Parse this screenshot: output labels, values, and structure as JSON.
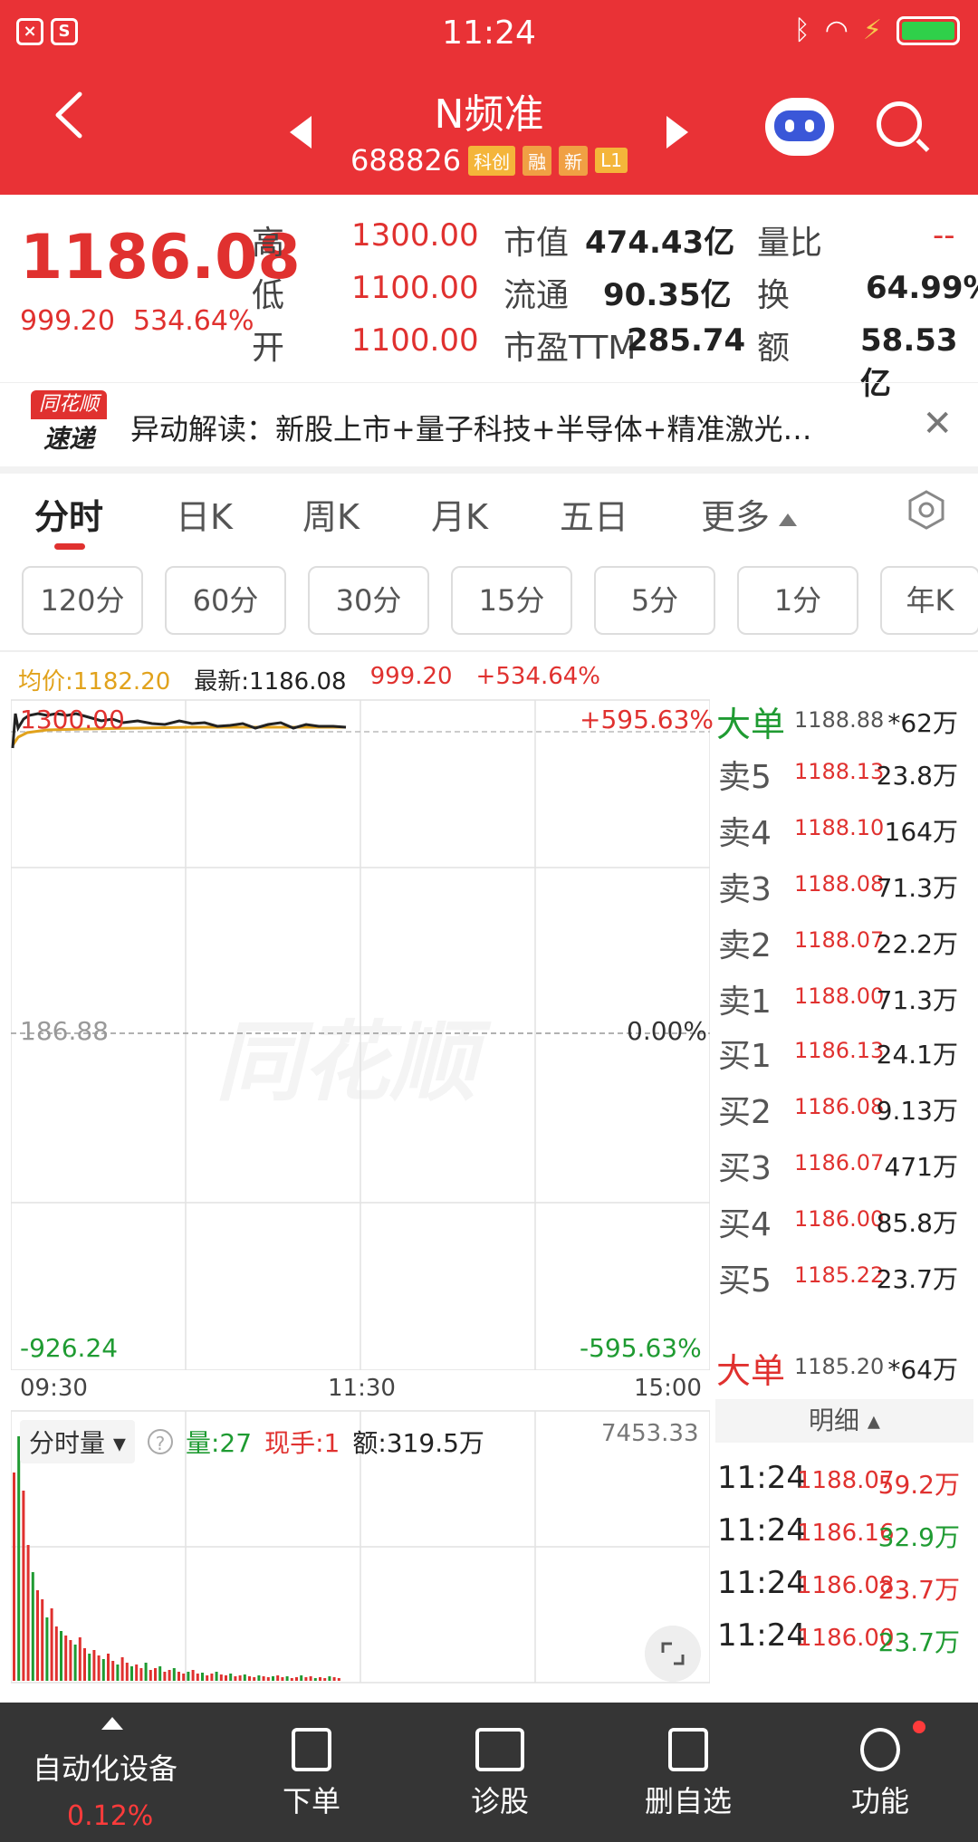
{
  "status_bar": {
    "time": "11:24",
    "left_icons": [
      "close-icon",
      "s-icon"
    ]
  },
  "header": {
    "name": "N频准",
    "code": "688826",
    "tags": [
      "科创",
      "融",
      "新",
      "L1"
    ]
  },
  "quote": {
    "price": "1186.08",
    "change": "999.20",
    "change_pct": "534.64%",
    "high_label": "高",
    "high": "1300.00",
    "low_label": "低",
    "low": "1100.00",
    "open_label": "开",
    "open": "1100.00",
    "mcap_label": "市值",
    "mcap": "474.43亿",
    "float_label": "流通",
    "float": "90.35亿",
    "pe_label": "市盈TTM",
    "pe": "285.74",
    "vr_label": "量比",
    "vr": "--",
    "turnover_label": "换",
    "turnover": "64.99%",
    "amount_label": "额",
    "amount": "58.53亿"
  },
  "alert": {
    "logo_top": "同花顺",
    "logo_bottom": "速递",
    "text": "异动解读：新股上市+量子科技+半导体+精准激光…"
  },
  "tabs": [
    "分时",
    "日K",
    "周K",
    "月K",
    "五日",
    "更多"
  ],
  "periods": [
    "120分",
    "60分",
    "30分",
    "15分",
    "5分",
    "1分",
    "年K"
  ],
  "chart_info": {
    "avg": "均价:1182.20",
    "latest": "最新:1186.08",
    "change": "999.20",
    "pct": "+534.64%"
  },
  "chart": {
    "top_price": "1300.00",
    "top_pct": "+595.63%",
    "mid_price": "186.88",
    "mid_pct": "0.00%",
    "bottom_price": "-926.24",
    "bottom_pct": "-595.63%",
    "times": [
      "09:30",
      "11:30",
      "15:00"
    ],
    "colors": {
      "price": "#222222",
      "avg": "#e1a21c"
    }
  },
  "book": {
    "big_sell": {
      "label": "大单",
      "price": "1188.88",
      "vol": "*62万"
    },
    "asks": [
      {
        "side": "卖5",
        "price": "1188.13",
        "vol": "23.8万"
      },
      {
        "side": "卖4",
        "price": "1188.10",
        "vol": "164万"
      },
      {
        "side": "卖3",
        "price": "1188.08",
        "vol": "71.3万"
      },
      {
        "side": "卖2",
        "price": "1188.07",
        "vol": "22.2万"
      },
      {
        "side": "卖1",
        "price": "1188.00",
        "vol": "71.3万"
      }
    ],
    "bids": [
      {
        "side": "买1",
        "price": "1186.13",
        "vol": "24.1万"
      },
      {
        "side": "买2",
        "price": "1186.08",
        "vol": "9.13万"
      },
      {
        "side": "买3",
        "price": "1186.07",
        "vol": "471万"
      },
      {
        "side": "买4",
        "price": "1186.00",
        "vol": "85.8万"
      },
      {
        "side": "买5",
        "price": "1185.22",
        "vol": "23.7万"
      }
    ],
    "big_buy": {
      "label": "大单",
      "price": "1185.20",
      "vol": "*64万"
    }
  },
  "volume": {
    "selector": "分时量",
    "qty": "量:27",
    "hand": "现手:1",
    "amount": "额:319.5万",
    "max": "7453.33"
  },
  "detail": {
    "header": "明细",
    "rows": [
      {
        "time": "11:24",
        "price": "1188.07",
        "vol": "59.2万",
        "dir": "up"
      },
      {
        "time": "11:24",
        "price": "1186.16",
        "vol": "32.9万",
        "dir": "down"
      },
      {
        "time": "11:24",
        "price": "1186.08",
        "vol": "23.7万",
        "dir": "up"
      },
      {
        "time": "11:24",
        "price": "1186.00",
        "vol": "23.7万",
        "dir": "down"
      }
    ]
  },
  "bottom_bar": {
    "sector": "自动化设备",
    "sector_pct": "0.12%",
    "items": [
      {
        "label": "下单",
        "icon": "document-icon"
      },
      {
        "label": "诊股",
        "icon": "medical-kit-icon"
      },
      {
        "label": "删自选",
        "icon": "minus-box-icon"
      },
      {
        "label": "功能",
        "icon": "menu-circle-icon"
      }
    ]
  }
}
